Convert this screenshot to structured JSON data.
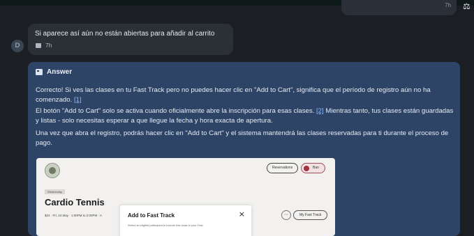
{
  "previous_message": {
    "time": "7h"
  },
  "corner_icon": "⚖",
  "user_message": {
    "avatar": "D",
    "text": "Si aparece así aún no están abiertas para añadir al carrito",
    "time": "7h"
  },
  "answer": {
    "title": "Answer",
    "p1_text": "Correcto! Si ves las clases en tu Fast Track pero no puedes hacer clic en \"Add to Cart\", significa que el período de registro aún no ha comenzado.",
    "p1_cite": "[1]",
    "p2_text": "El botón \"Add to Cart\" solo se activa cuando oficialmente abre la inscripción para esas clases.",
    "p2_cite": "[2]",
    "p2_rest": "Mientras tanto, tus clases están guardadas y listas - solo necesitas esperar a que llegue la fecha y hora exacta de apertura.",
    "p3_text": "Una vez que abra el registro, podrás hacer clic en \"Add to Cart\" y el sistema mantendrá las clases reservadas para ti durante el proceso de pago."
  },
  "embedded_screenshot": {
    "reservations_label": "Reservations",
    "user_label": "Ban",
    "tag": "Wednesday",
    "class_title": "Cardio Tennis",
    "class_meta": "$24  ·  Fri, 24 May  ·  1:00PM to 2:00PM  ·  A",
    "my_fast_track_label": "My Fast Track",
    "modal": {
      "title": "Add to Fast Track",
      "close": "×",
      "subtitle": "Select an eligible participant to include this class in your Fast"
    }
  },
  "colors": {
    "background": "#1b1f24",
    "user_bubble": "#2b2f36",
    "answer_card": "#2d4466",
    "citation": "#8fb6ff"
  }
}
